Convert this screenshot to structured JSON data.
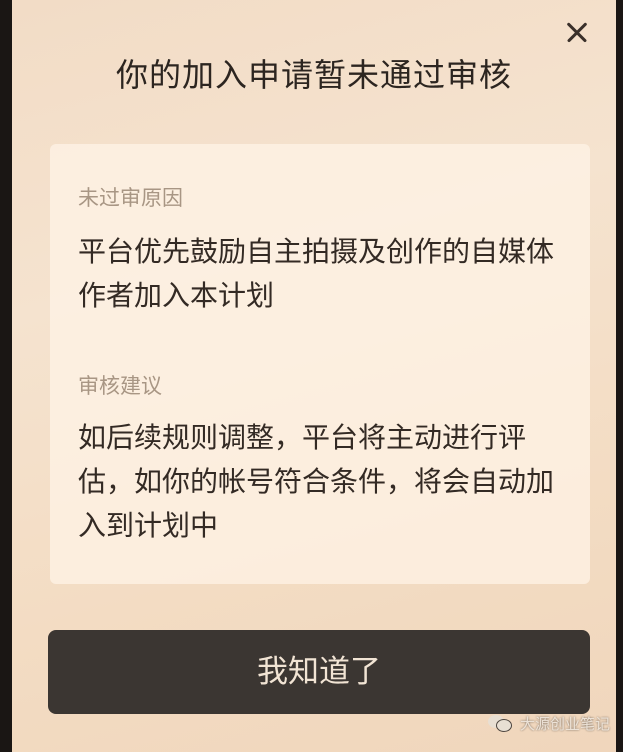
{
  "dialog": {
    "title": "你的加入申请暂未通过审核",
    "close_icon": "close-icon",
    "reason_label": "未过审原因",
    "reason_text": "平台优先鼓励自主拍摄及创作的自媒体作者加入本计划",
    "advice_label": "审核建议",
    "advice_text": "如后续规则调整，平台将主动进行评估，如你的帐号符合条件，将会自动加入到计划中",
    "confirm_label": "我知道了"
  },
  "watermark": {
    "icon": "wechat-icon",
    "text": "大源创业笔记"
  },
  "colors": {
    "button_bg": "#3b3632",
    "button_text": "#f1e4d4",
    "dialog_bg": "#f4e0cb",
    "label_text": "#a89684",
    "body_text": "#332a24"
  }
}
